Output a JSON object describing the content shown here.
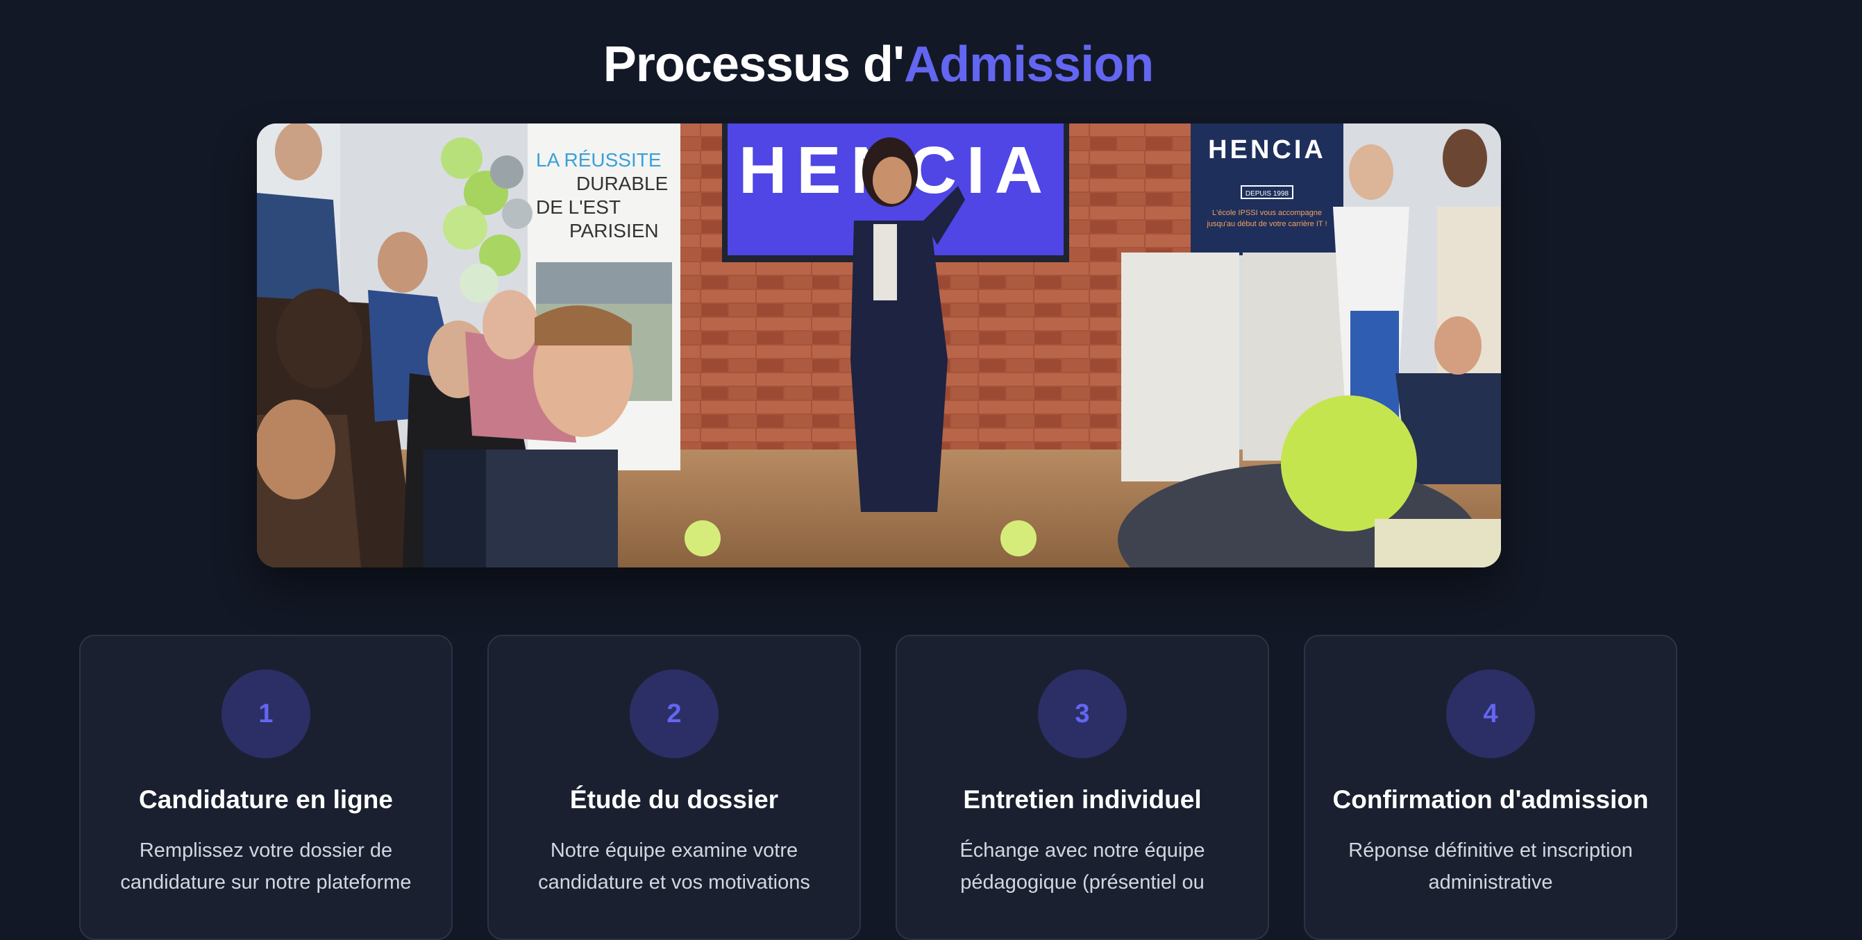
{
  "section": {
    "title_prefix": "Processus d'",
    "title_accent": "Admission"
  },
  "hero": {
    "screen_logo": "HENCIA",
    "banner_left": [
      "LA RÉUSSITE",
      "DURABLE",
      "DE L'EST",
      "PARISIEN"
    ],
    "banner_right_logo": "HENCIA",
    "banner_right_badge": "DEPUIS 1998",
    "banner_right_text": [
      "L'école IPSSI vous accompagne",
      "jusqu'au début de votre carrière IT !"
    ]
  },
  "steps": [
    {
      "number": "1",
      "title": "Candidature en ligne",
      "desc": "Remplissez votre dossier de candidature sur notre plateforme"
    },
    {
      "number": "2",
      "title": "Étude du dossier",
      "desc": "Notre équipe examine votre candidature et vos motivations"
    },
    {
      "number": "3",
      "title": "Entretien individuel",
      "desc": "Échange avec notre équipe pédagogique (présentiel ou"
    },
    {
      "number": "4",
      "title": "Confirmation d'admission",
      "desc": "Réponse définitive et inscription administrative"
    }
  ],
  "colors": {
    "background": "#131826",
    "accent": "#6366f1",
    "card": "#1b2030",
    "number_circle": "#2c2f66"
  }
}
